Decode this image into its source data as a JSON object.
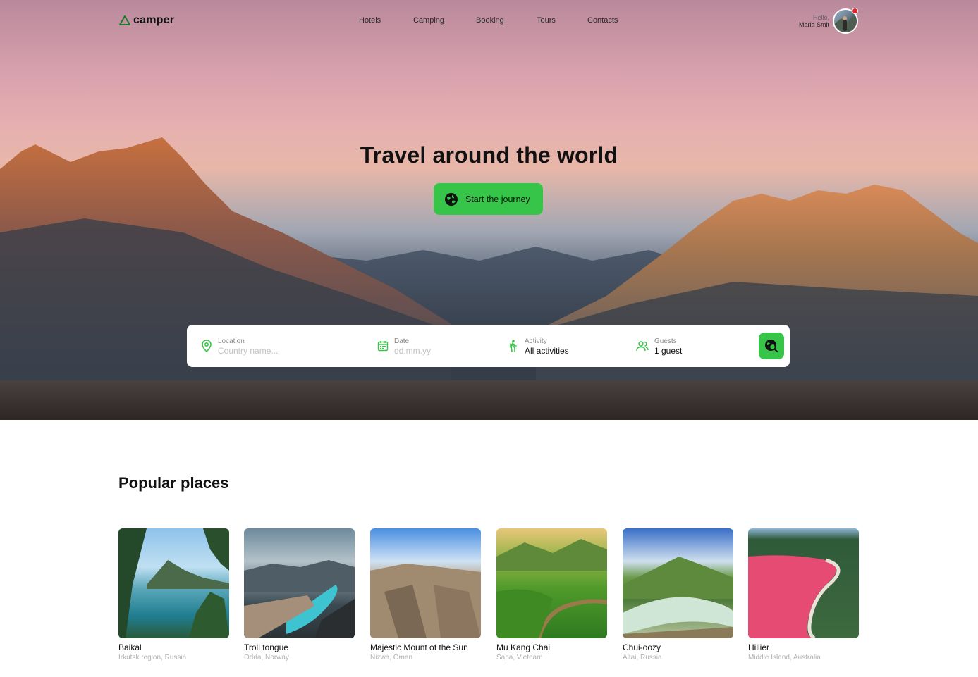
{
  "brand": {
    "name": "camper",
    "accent": "#36c548"
  },
  "nav": {
    "items": [
      "Hotels",
      "Camping",
      "Booking",
      "Tours",
      "Contacts"
    ]
  },
  "user": {
    "greeting": "Hello,",
    "name": "Maria Smit",
    "has_notification": true
  },
  "hero": {
    "title": "Travel around the world",
    "cta_label": "Start the journey",
    "cta_icon": "globe-icon"
  },
  "search": {
    "location": {
      "label": "Location",
      "placeholder": "Country name...",
      "icon": "location-pin-icon"
    },
    "date": {
      "label": "Date",
      "placeholder": "dd.mm.yy",
      "icon": "calendar-icon"
    },
    "activity": {
      "label": "Activity",
      "value": "All activities",
      "icon": "hiker-icon"
    },
    "guests": {
      "label": "Guests",
      "value": "1 guest",
      "icon": "users-icon"
    },
    "button_icon": "search-globe-icon"
  },
  "popular": {
    "title": "Popular places",
    "places": [
      {
        "name": "Baikal",
        "region": "Irkutsk region, Russia"
      },
      {
        "name": "Troll tongue",
        "region": "Odda, Norway"
      },
      {
        "name": "Majestic Mount of the Sun",
        "region": "Nizwa, Oman"
      },
      {
        "name": "Mu Kang Chai",
        "region": "Sapa, Vietnam"
      },
      {
        "name": "Chui-oozy",
        "region": "Altai, Russia"
      },
      {
        "name": "Hillier",
        "region": "Middle Island, Australia"
      }
    ]
  }
}
